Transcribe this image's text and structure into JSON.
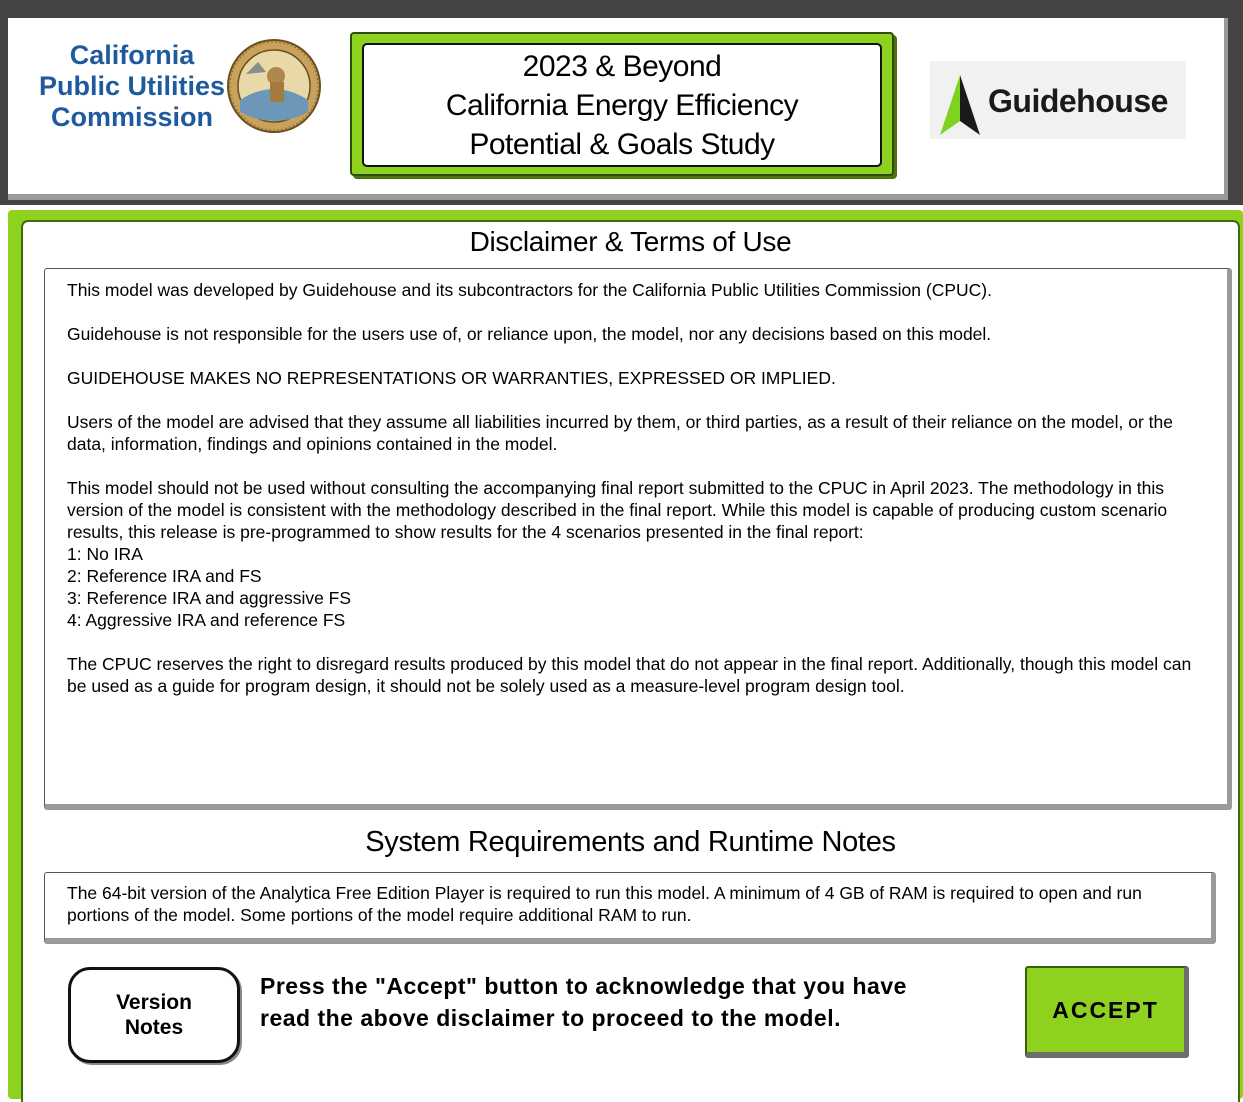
{
  "header": {
    "cpuc_logo": {
      "lines": [
        "California",
        "Public Utilities",
        "Commission"
      ],
      "seal_text": "PUBLIC UTILITIES COMMISSION · STATE OF CALIFORNIA",
      "color": "#1f5a9e"
    },
    "title": {
      "lines": [
        "2023 & Beyond",
        "California Energy Efficiency",
        "Potential & Goals Study"
      ]
    },
    "guidehouse_logo": {
      "text": "Guidehouse"
    }
  },
  "disclaimer": {
    "heading": "Disclaimer & Terms of Use",
    "paragraphs": [
      "This model was developed by Guidehouse and its subcontractors for the California Public Utilities Commission (CPUC).",
      "Guidehouse is not responsible for the users use of, or reliance upon, the model, nor any decisions based on this model.",
      "GUIDEHOUSE MAKES NO REPRESENTATIONS OR WARRANTIES, EXPRESSED OR IMPLIED.",
      "Users of the model are advised that they assume all liabilities incurred by them, or third parties, as a result of their reliance on the model, or the data, information, findings and opinions contained in the model."
    ],
    "scenario_intro": "This model should not be used without consulting the accompanying final report submitted to the CPUC in April 2023. The methodology in this version of the model is consistent with the methodology described in the final report. While this model is capable of producing custom scenario results, this release is pre-programmed to show results for the 4 scenarios presented in the final report:",
    "scenarios": [
      "1: No IRA",
      "2: Reference IRA and FS",
      "3: Reference IRA and aggressive FS",
      "4: Aggressive IRA and reference FS"
    ],
    "closing": "The CPUC reserves the right to disregard results produced by this model that do not appear in the final report. Additionally, though this model can be used as a guide for program design, it should not be solely used as a measure-level program design tool."
  },
  "system_requirements": {
    "heading": "System Requirements and Runtime Notes",
    "text": "The 64-bit version of the Analytica Free Edition Player is required to run this model. A minimum of 4 GB of RAM is required to open and run portions of the model.  Some portions of the model require additional RAM to run."
  },
  "footer": {
    "version_notes_lines": [
      "Version",
      "Notes"
    ],
    "instructions_lines": [
      "Press the \"Accept\" button to acknowledge that you have",
      "read the above disclaimer to proceed to the model."
    ],
    "accept_label": "ACCEPT"
  },
  "colors": {
    "accent_green": "#8fd11f",
    "header_bg": "#444444",
    "cpuc_blue": "#1f5a9e"
  }
}
